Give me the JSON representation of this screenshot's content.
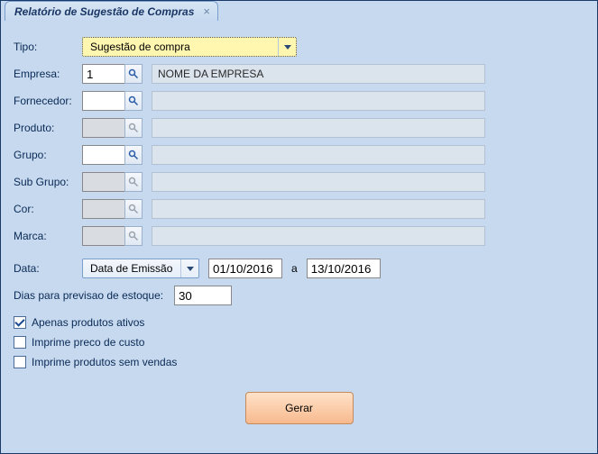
{
  "tab": {
    "title": "Relatório de Sugestão de Compras"
  },
  "labels": {
    "tipo": "Tipo:",
    "empresa": "Empresa:",
    "fornecedor": "Fornecedor:",
    "produto": "Produto:",
    "grupo": "Grupo:",
    "subgrupo": "Sub Grupo:",
    "cor": "Cor:",
    "marca": "Marca:",
    "data": "Data:",
    "dias": "Dias para previsao de estoque:",
    "date_sep": "a"
  },
  "fields": {
    "tipo": {
      "value": "Sugestão de compra"
    },
    "empresa": {
      "code": "1",
      "display": "NOME DA EMPRESA"
    },
    "fornecedor": {
      "code": "",
      "display": ""
    },
    "produto": {
      "code": "",
      "display": ""
    },
    "grupo": {
      "code": "",
      "display": ""
    },
    "subgrupo": {
      "code": "",
      "display": ""
    },
    "cor": {
      "code": "",
      "display": ""
    },
    "marca": {
      "code": "",
      "display": ""
    },
    "data_tipo": {
      "value": "Data de Emissão"
    },
    "data_de": "01/10/2016",
    "data_ate": "13/10/2016",
    "dias": "30"
  },
  "checks": {
    "ativos": {
      "label": "Apenas produtos ativos",
      "checked": true
    },
    "preco": {
      "label": "Imprime preco de custo",
      "checked": false
    },
    "semvendas": {
      "label": "Imprime produtos sem vendas",
      "checked": false
    }
  },
  "buttons": {
    "gerar": "Gerar"
  }
}
